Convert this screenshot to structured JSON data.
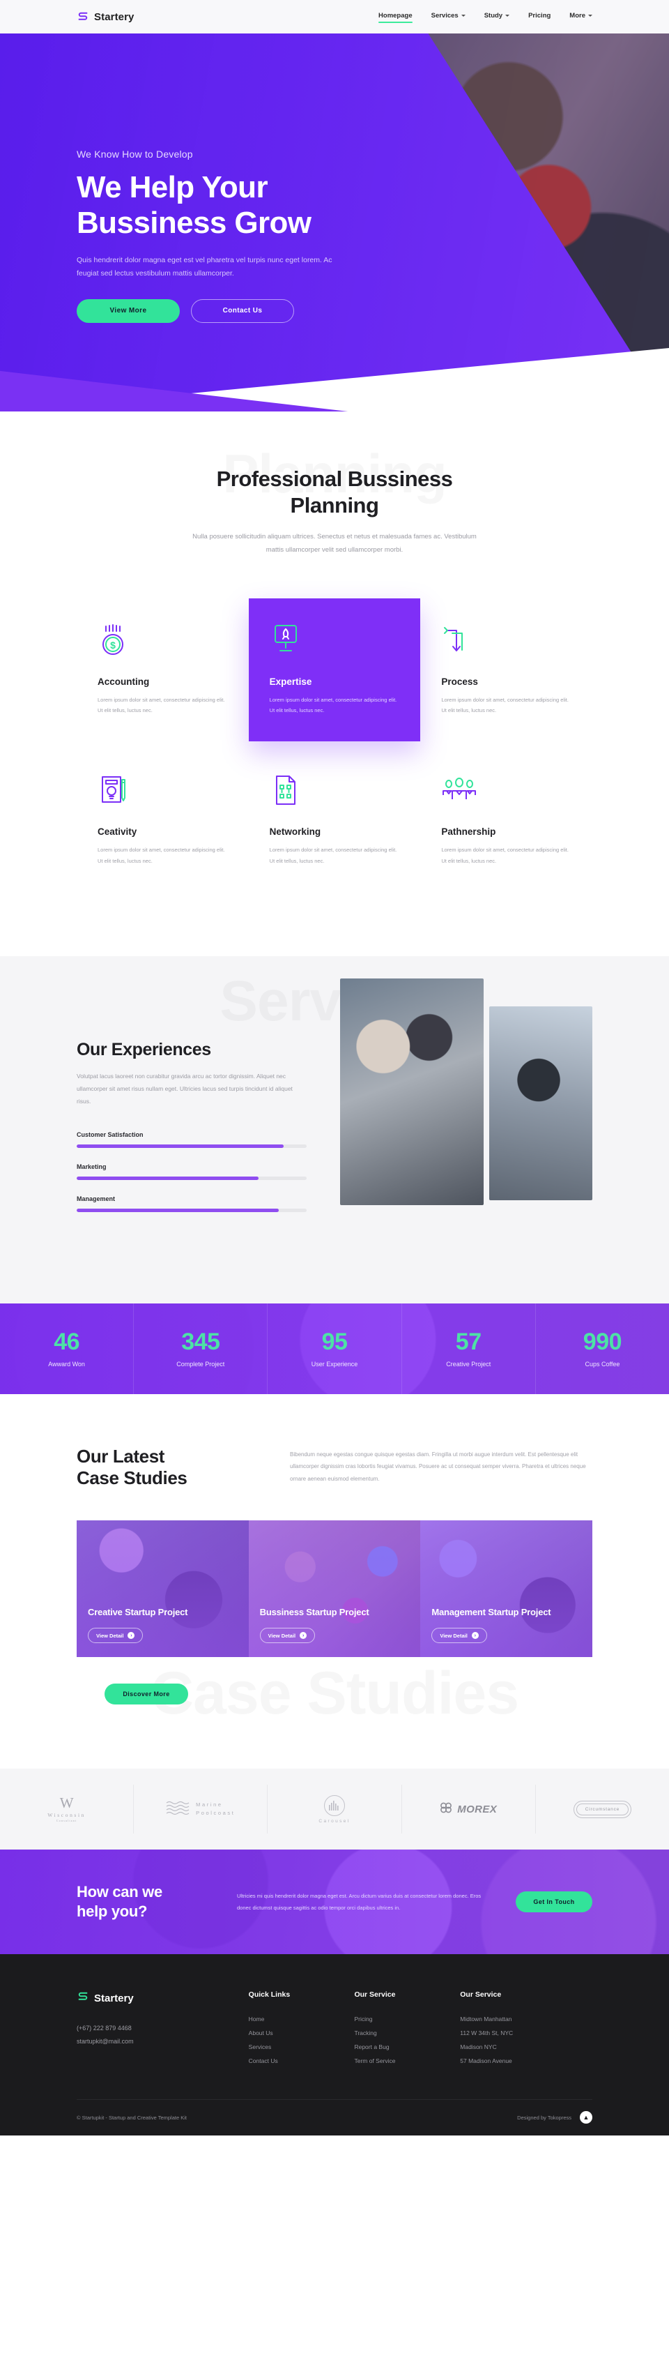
{
  "header": {
    "brand": "Startery",
    "brand_icon": "startery-s-logo-icon",
    "nav": [
      {
        "label": "Homepage",
        "has_caret": false,
        "active": true
      },
      {
        "label": "Services",
        "has_caret": true,
        "active": false
      },
      {
        "label": "Study",
        "has_caret": true,
        "active": false
      },
      {
        "label": "Pricing",
        "has_caret": false,
        "active": false
      },
      {
        "label": "More",
        "has_caret": true,
        "active": false
      }
    ]
  },
  "hero": {
    "eyebrow": "We Know How to Develop",
    "title_line1": "We Help Your",
    "title_line2": "Bussiness Grow",
    "paragraph": "Quis hendrerit dolor magna eget est vel pharetra vel turpis nunc eget lorem. Ac feugiat sed lectus vestibulum mattis ullamcorper.",
    "primary_button": "View More",
    "secondary_button": "Contact Us"
  },
  "planning": {
    "ghost_word": "Planning",
    "title": "Professional Bussiness Planning",
    "subtitle": "Nulla posuere sollicitudin aliquam ultrices. Senectus et netus et malesuada fames ac. Vestibulum mattis ullamcorper velit sed ullamcorper morbi.",
    "cards": [
      {
        "icon": "coin-dollar-icon",
        "title": "Accounting",
        "text": "Lorem ipsum dolor sit amet, consectetur adipiscing elit. Ut elit tellus, luctus nec.",
        "featured": false
      },
      {
        "icon": "monitor-rocket-icon",
        "title": "Expertise",
        "text": "Lorem ipsum dolor sit amet, consectetur adipiscing elit. Ut elit tellus, luctus nec.",
        "featured": true
      },
      {
        "icon": "arrows-process-icon",
        "title": "Process",
        "text": "Lorem ipsum dolor sit amet, consectetur adipiscing elit. Ut elit tellus, luctus nec.",
        "featured": false
      },
      {
        "icon": "lightbulb-pencil-icon",
        "title": "Ceativity",
        "text": "Lorem ipsum dolor sit amet, consectetur adipiscing elit. Ut elit tellus, luctus nec.",
        "featured": false
      },
      {
        "icon": "document-grid-icon",
        "title": "Networking",
        "text": "Lorem ipsum dolor sit amet, consectetur adipiscing elit. Ut elit tellus, luctus nec.",
        "featured": false
      },
      {
        "icon": "people-group-icon",
        "title": "Pathnership",
        "text": "Lorem ipsum dolor sit amet, consectetur adipiscing elit. Ut elit tellus, luctus nec.",
        "featured": false
      }
    ]
  },
  "experiences": {
    "ghost_word": "Services",
    "title": "Our Experiences",
    "paragraph": "Volutpat lacus laoreet non curabitur gravida arcu ac tortor dignissim. Aliquet nec ullamcorper sit amet risus nullam eget. Ultricies lacus sed turpis tincidunt id aliquet risus.",
    "bars": [
      {
        "label": "Customer Satisfaction",
        "percent": 90
      },
      {
        "label": "Marketing",
        "percent": 79
      },
      {
        "label": "Management",
        "percent": 88
      }
    ]
  },
  "counters": [
    {
      "value": "46",
      "label": "Awward Won"
    },
    {
      "value": "345",
      "label": "Complete Project"
    },
    {
      "value": "95",
      "label": "User Experience"
    },
    {
      "value": "57",
      "label": "Creative Project"
    },
    {
      "value": "990",
      "label": "Cups Coffee"
    }
  ],
  "cases": {
    "ghost_word": "Case Studies",
    "title_line1": "Our Latest",
    "title_line2": "Case Studies",
    "paragraph": "Bibendum neque egestas congue quisque egestas diam. Fringilla ut morbi augue interdum velit. Est pellentesque elit ullamcorper dignissim cras lobortis feugiat vivamus. Posuere ac ut consequat semper viverra. Pharetra et ultrices neque ornare aenean euismod elementum.",
    "items": [
      {
        "title": "Creative Startup Project",
        "button": "View Detail"
      },
      {
        "title": "Bussiness Startup Project",
        "button": "View Detail"
      },
      {
        "title": "Management Startup Project",
        "button": "View Detail"
      }
    ],
    "discover_button": "Discover More"
  },
  "logos": [
    {
      "name": "Wisconsin",
      "sub": "Consultant",
      "mark": "W"
    },
    {
      "name": "Marine",
      "sub": "Poolcoast",
      "mark": "waves-icon"
    },
    {
      "name": "Carousel",
      "mark": "bars-circle-icon"
    },
    {
      "name": "MOREX",
      "mark": "clover-icon"
    },
    {
      "name": "Circumstance",
      "mark": "pill-outline-icon"
    }
  ],
  "cta": {
    "title_line1": "How can we",
    "title_line2": "help you?",
    "paragraph": "Ultricies mi quis hendrerit dolor magna eget est. Arcu dictum varius duis at consectetur lorem donec. Eros donec dictumst quisque sagittis ac odio tempor orci dapibus ultrices in.",
    "button": "Get In Touch"
  },
  "footer": {
    "brand": "Startery",
    "phone": "(+67) 222 879 4468",
    "email": "startupkit@mail.com",
    "columns": [
      {
        "head": "Quick Links",
        "links": [
          "Home",
          "About Us",
          "Services",
          "Contact Us"
        ]
      },
      {
        "head": "Our Service",
        "links": [
          "Pricing",
          "Tracking",
          "Report a Bug",
          "Term of Service"
        ]
      },
      {
        "head": "Our Service",
        "links": [
          "Midtown Manhattan",
          "112 W 34th St, NYC",
          "Madison NYC",
          "57 Madison Avenue"
        ]
      }
    ],
    "copyright": "© Startupkit - Startup and Creative Template Kit",
    "designed_by": "Designed by Tokopress",
    "to_top_icon": "arrow-up-icon"
  },
  "colors": {
    "purple": "#7b2ff7",
    "green": "#32e39a",
    "dark": "#1b1b1d"
  }
}
